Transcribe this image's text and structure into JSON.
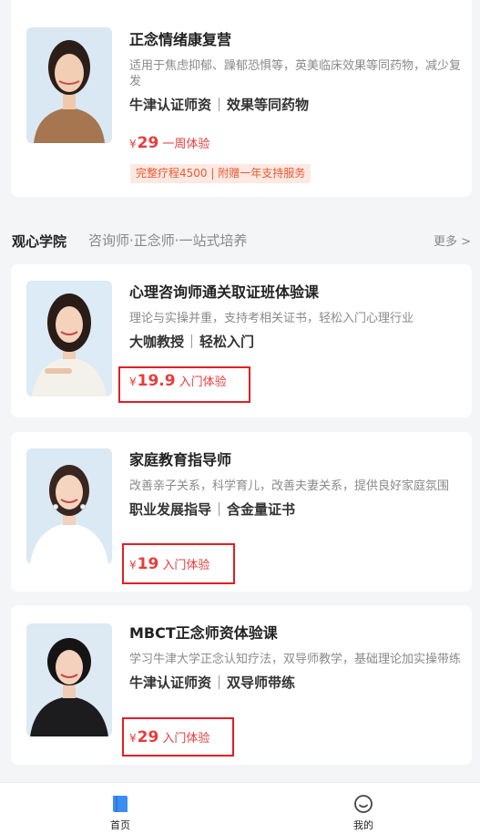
{
  "courses_top": {
    "title": "正念情绪康复营",
    "desc": "适用于焦虑抑郁、躁郁恐惧等，英美临床效果等同药物，减少复发",
    "tag1": "牛津认证师资",
    "tag2": "效果等同药物",
    "currency": "¥",
    "price": "29",
    "price_label": "一周体验",
    "badge": "完整疗程4500 | 附赠一年支持服务"
  },
  "section": {
    "title": "观心学院",
    "subtitle": "咨询师·正念师·一站式培养",
    "more": "更多 >"
  },
  "courses": [
    {
      "title": "心理咨询师通关取证班体验课",
      "desc": "理论与实操并重，支持考相关证书，轻松入门心理行业",
      "tag1": "大咖教授",
      "tag2": "轻松入门",
      "currency": "¥",
      "price": "19.9",
      "price_label": "入门体验"
    },
    {
      "title": "家庭教育指导师",
      "desc": "改善亲子关系，科学育儿，改善夫妻关系，提供良好家庭氛围",
      "tag1": "职业发展指导",
      "tag2": "含金量证书",
      "currency": "¥",
      "price": "19",
      "price_label": "入门体验"
    },
    {
      "title": "MBCT正念师资体验课",
      "desc": "学习牛津大学正念认知疗法，双导师教学，基础理论加实操带练",
      "tag1": "牛津认证师资",
      "tag2": "双导师带练",
      "currency": "¥",
      "price": "29",
      "price_label": "入门体验"
    }
  ],
  "tabbar": {
    "home_label": "首页",
    "mine_label": "我的",
    "home_icon": "book-icon",
    "mine_icon": "smile-face-icon",
    "active_color": "#3a8ef0"
  },
  "colors": {
    "price": "#e83c3c",
    "highlight_box": "#e31e24",
    "badge_bg": "#fde9e2",
    "badge_text": "#e85a34"
  }
}
